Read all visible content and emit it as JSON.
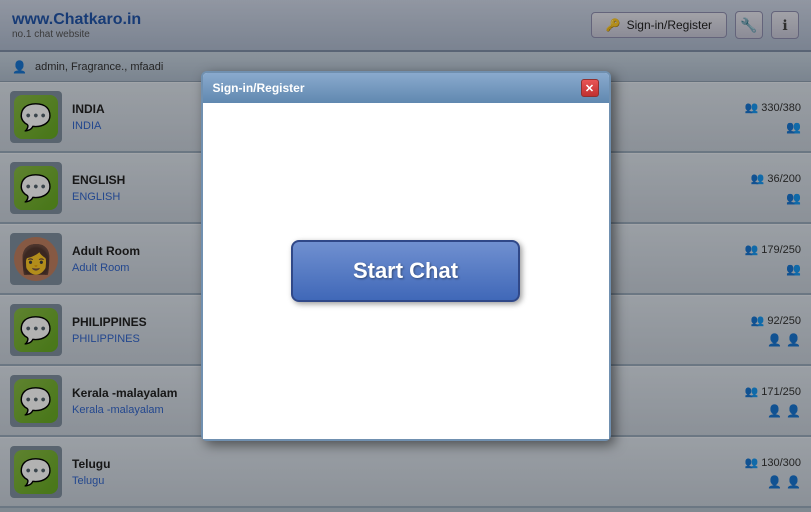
{
  "header": {
    "logo_title": "www.Chatkaro.in",
    "logo_subtitle": "no.1 chat website",
    "signin_label": "Sign-in/Register",
    "signin_icon": "🔑",
    "settings_icon": "🔧",
    "info_icon": "ℹ"
  },
  "admin_bar": {
    "icon": "👤",
    "text": "admin, Fragrance., mfaadi"
  },
  "rooms": [
    {
      "name": "INDIA",
      "link": "INDIA",
      "count": "330/380",
      "type": "chat",
      "icons": [
        "👥"
      ]
    },
    {
      "name": "ENGLISH",
      "link": "ENGLISH",
      "count": "36/200",
      "type": "chat",
      "icons": [
        "👥"
      ]
    },
    {
      "name": "Adult Room",
      "link": "Adult Room",
      "count": "179/250",
      "type": "adult",
      "icons": [
        "👥"
      ]
    },
    {
      "name": "PHILIPPINES",
      "link": "PHILIPPINES",
      "count": "92/250",
      "type": "chat",
      "icons": [
        "👤",
        "👤"
      ]
    },
    {
      "name": "Kerala -malayalam",
      "link": "Kerala -malayalam",
      "count": "171/250",
      "type": "chat",
      "icons": [
        "👤",
        "👤"
      ]
    },
    {
      "name": "Telugu",
      "link": "Telugu",
      "count": "130/300",
      "type": "chat",
      "icons": [
        "👤",
        "👤"
      ]
    }
  ],
  "modal": {
    "title": "Sign-in/Register",
    "close_icon": "✕",
    "start_chat_label": "Start Chat"
  }
}
